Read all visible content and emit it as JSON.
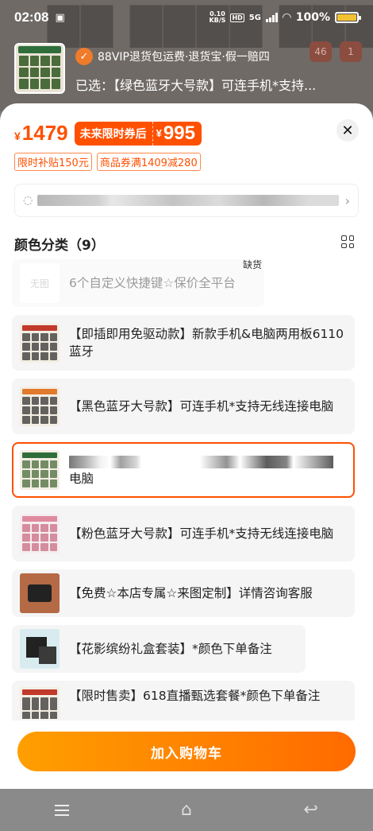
{
  "status_bar": {
    "time": "02:08",
    "net_speed_value": "0.10",
    "net_speed_unit": "KB/S",
    "hd": "HD",
    "network": "5G",
    "battery": "100%"
  },
  "header": {
    "guarantee_text": "88VIP退货包运费·退货宝·假一赔四",
    "selected_text": "已选：【绿色蓝牙大号款】可连手机*支持...",
    "badges": [
      "46",
      "1"
    ]
  },
  "price": {
    "currency": "¥",
    "original": "1479",
    "coupon_label": "未来限时券后",
    "coupon_price": "995"
  },
  "tags": [
    "限时补贴150元",
    "商品券满1409减280"
  ],
  "address": {
    "arrow": "›"
  },
  "section": {
    "title": "颜色分类（9）"
  },
  "options": [
    {
      "label": "6个自定义快捷键☆保价全平台",
      "img_text": "无图",
      "badge": "缺货",
      "disabled": true
    },
    {
      "label": "【即插即用免驱动款】新款手机&电脑两用板6110蓝牙"
    },
    {
      "label": "【黑色蓝牙大号款】可连手机*支持无线连接电脑"
    },
    {
      "label_suffix": "电脑",
      "selected": true
    },
    {
      "label": "【粉色蓝牙大号款】可连手机*支持无线连接电脑"
    },
    {
      "label": "【免费☆本店专属☆来图定制】详情咨询客服"
    },
    {
      "label": "【花影缤纷礼盒套装】*颜色下单备注"
    },
    {
      "label": "【限时售卖】618直播甄选套餐*颜色下单备注"
    }
  ],
  "cart_button": {
    "label": "加入购物车"
  },
  "colors": {
    "accent": "#ff5000",
    "button_start": "#ff9f00",
    "button_end": "#ff6a00"
  }
}
